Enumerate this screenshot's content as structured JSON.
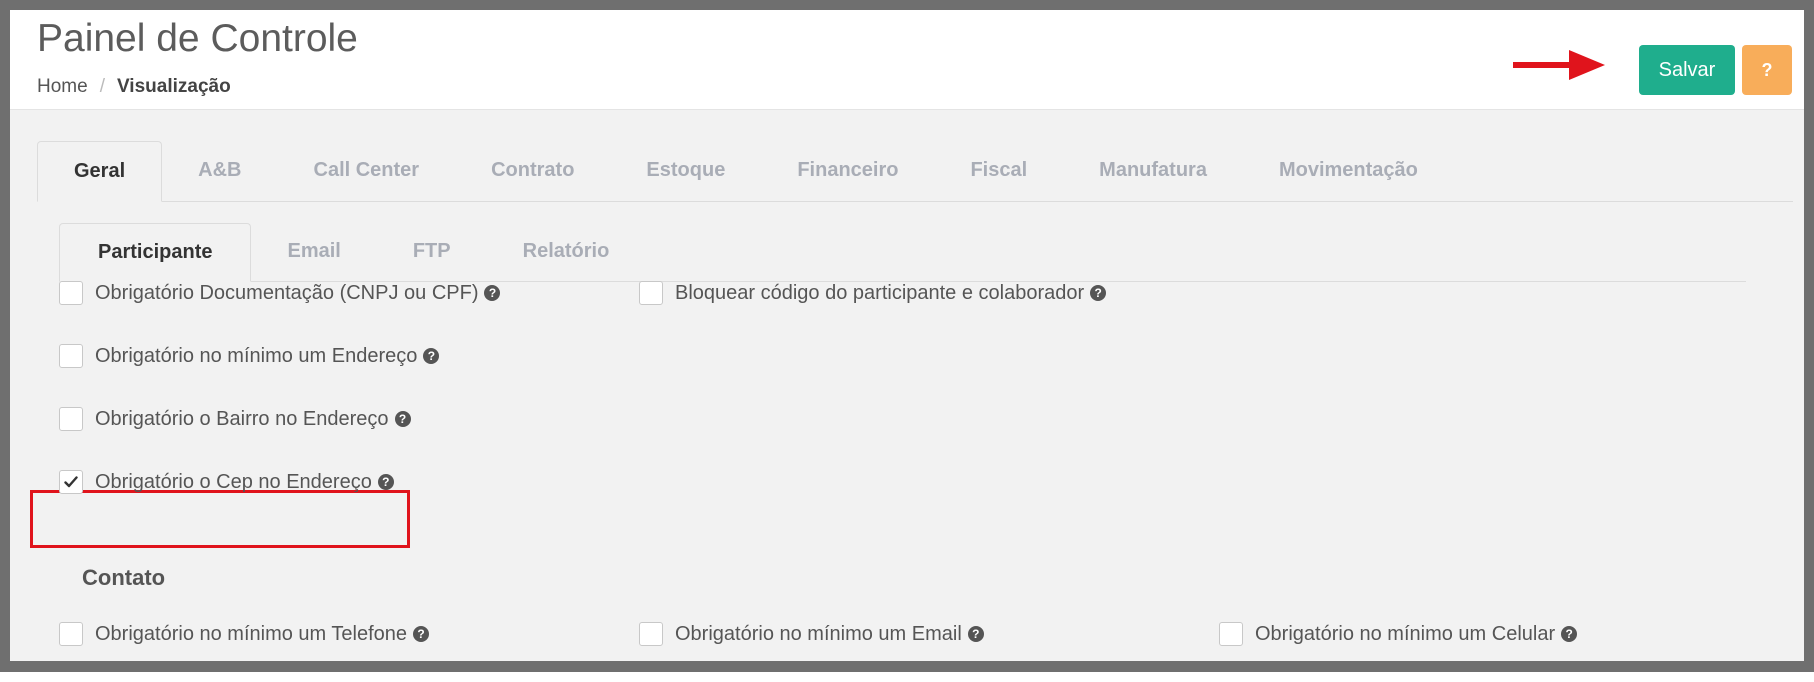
{
  "header": {
    "title": "Painel de Controle",
    "breadcrumb": {
      "home": "Home",
      "separator": "/",
      "current": "Visualização"
    },
    "save_label": "Salvar",
    "help_label": "?"
  },
  "colors": {
    "save_button": "#1fae8d",
    "help_button": "#f8ad5a",
    "highlight": "#e0141c",
    "arrow": "#e0141c"
  },
  "main_tabs": [
    {
      "label": "Geral",
      "active": true
    },
    {
      "label": "A&B"
    },
    {
      "label": "Call Center"
    },
    {
      "label": "Contrato"
    },
    {
      "label": "Estoque"
    },
    {
      "label": "Financeiro"
    },
    {
      "label": "Fiscal"
    },
    {
      "label": "Manufatura"
    },
    {
      "label": "Movimentação"
    }
  ],
  "sub_tabs": [
    {
      "label": "Participante",
      "active": true
    },
    {
      "label": "Email"
    },
    {
      "label": "FTP"
    },
    {
      "label": "Relatório"
    }
  ],
  "participante_options": [
    {
      "label": "Obrigatório Documentação (CNPJ ou CPF)",
      "checked": false
    },
    {
      "label": "Bloquear código do participante e colaborador",
      "checked": false
    },
    {
      "label": "Obrigatório no mínimo um Endereço",
      "checked": false
    },
    {
      "label": "Obrigatório o Bairro no Endereço",
      "checked": false
    },
    {
      "label": "Obrigatório o Cep no Endereço",
      "checked": true
    }
  ],
  "contato": {
    "title": "Contato",
    "options": [
      {
        "label": "Obrigatório no mínimo um Telefone",
        "checked": false
      },
      {
        "label": "Obrigatório no mínimo um Email",
        "checked": false
      },
      {
        "label": "Obrigatório no mínimo um Celular",
        "checked": false
      }
    ]
  },
  "icons": {
    "help": "question-circle-icon",
    "check": "checkmark-icon",
    "arrow": "red-arrow-right"
  }
}
